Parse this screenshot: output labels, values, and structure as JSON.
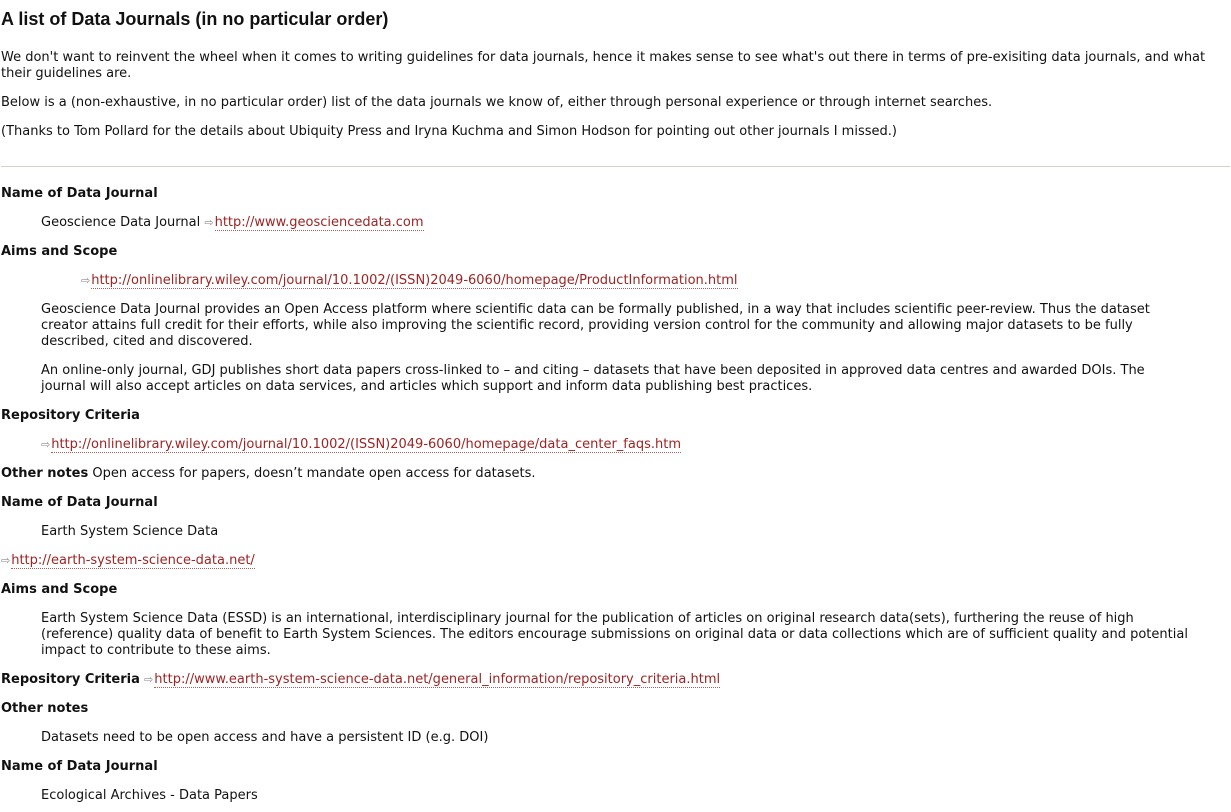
{
  "title": "A list of Data Journals (in no particular order)",
  "intro": {
    "p1": "We don't want to reinvent the wheel when it comes to writing guidelines for data journals, hence it makes sense to see what's out there in terms of pre-exisiting data journals, and what their guidelines are.",
    "p2": "Below is a (non-exhaustive, in no particular order) list of the data journals we know of, either through personal experience or through internet searches.",
    "p3": "(Thanks to Tom Pollard for the details about Ubiquity Press and Iryna Kuchma and Simon Hodson for pointing out other journals I missed.)"
  },
  "labels": {
    "name": "Name of Data Journal",
    "aims": "Aims and Scope",
    "repo": "Repository Criteria",
    "notes": "Other notes"
  },
  "journals": [
    {
      "name": "Geoscience Data Journal",
      "name_link": "http://www.geosciencedata.com",
      "aims_link": "http://onlinelibrary.wiley.com/journal/10.1002/(ISSN)2049-6060/homepage/ProductInformation.html",
      "aims_p1": "Geoscience Data Journal provides an Open Access platform where scientific data can be formally published, in a way that includes scientific peer-review. Thus the dataset creator attains full credit for their efforts, while also improving the scientific record, providing version control for the community and allowing major datasets to be fully described, cited and discovered.",
      "aims_p2": "An online-only journal, GDJ publishes short data papers cross-linked to – and citing – datasets that have been deposited in approved data centres and awarded DOIs. The journal will also accept articles on data services, and articles which support and inform data publishing best practices.",
      "repo_link": "http://onlinelibrary.wiley.com/journal/10.1002/(ISSN)2049-6060/homepage/data_center_faqs.htm",
      "notes": "Open access for papers, doesn’t mandate open access for datasets."
    },
    {
      "name": "Earth System Science Data",
      "site_link": "http://earth-system-science-data.net/",
      "aims_p1": "Earth System Science Data (ESSD) is an international, interdisciplinary journal for the publication of articles on original research data(sets), furthering the reuse of high (reference) quality data of benefit to Earth System Sciences. The editors encourage submissions on original data or data collections which are of sufficient quality and potential impact to contribute to these aims.",
      "repo_link": "http://www.earth-system-science-data.net/general_information/repository_criteria.html",
      "notes": "Datasets need to be open access and have a persistent ID (e.g. DOI)"
    },
    {
      "name": "Ecological Archives - Data Papers"
    }
  ],
  "icons": {
    "external_link": "external-link-icon"
  },
  "colors": {
    "link": "#9c2424",
    "separator": "#d6d2c4"
  }
}
